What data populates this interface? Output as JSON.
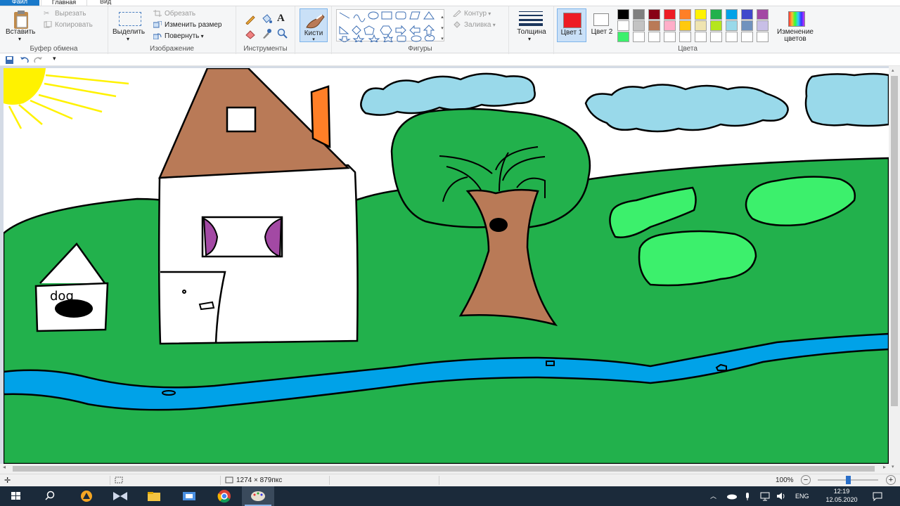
{
  "menu_tabs": {
    "file": "Файл",
    "home": "Главная",
    "view": "Вид"
  },
  "ribbon": {
    "clipboard": {
      "paste": "Вставить",
      "cut": "Вырезать",
      "copy": "Копировать",
      "label": "Буфер обмена"
    },
    "image": {
      "select": "Выделить",
      "crop": "Обрезать",
      "resize": "Изменить размер",
      "rotate": "Повернуть",
      "label": "Изображение"
    },
    "tools": {
      "label": "Инструменты"
    },
    "brushes": {
      "label": "Кисти"
    },
    "shapes": {
      "outline": "Контур",
      "fill": "Заливка",
      "label": "Фигуры"
    },
    "size": {
      "label": "Толщина"
    },
    "colors": {
      "color1": "Цвет 1",
      "color2": "Цвет 2",
      "edit": "Изменение цветов",
      "label": "Цвета",
      "color1_value": "#ed1c24",
      "color2_value": "#ffffff",
      "palette_row1": [
        "#000000",
        "#7f7f7f",
        "#880015",
        "#ed1c24",
        "#ff7f27",
        "#fff200",
        "#22b14c",
        "#00a2e8",
        "#3f48cc",
        "#a349a4"
      ],
      "palette_row2": [
        "#ffffff",
        "#c3c3c3",
        "#b97a57",
        "#ffaec9",
        "#ffc90e",
        "#efe4b0",
        "#b5e61d",
        "#99d9ea",
        "#7092be",
        "#c8bfe7"
      ],
      "palette_row3": [
        "#3cf06c",
        "#ffffff",
        "#ffffff",
        "#ffffff",
        "#ffffff",
        "#ffffff",
        "#ffffff",
        "#ffffff",
        "#ffffff",
        "#ffffff"
      ]
    }
  },
  "drawing": {
    "label": "dog",
    "colors": {
      "sky": "#ffffff",
      "grass": "#22b14c",
      "river": "#00a2e8",
      "roof": "#b97a57",
      "chimney": "#ff7f27",
      "curtain": "#a349a4",
      "cloud": "#99d9ea",
      "bush": "#3cf06c",
      "sun": "#fff200",
      "trunk": "#b97a57"
    }
  },
  "status": {
    "dimensions": "1274 × 879пкс",
    "zoom": "100%"
  },
  "taskbar": {
    "lang": "ENG",
    "time": "12:19",
    "date": "12.05.2020"
  }
}
